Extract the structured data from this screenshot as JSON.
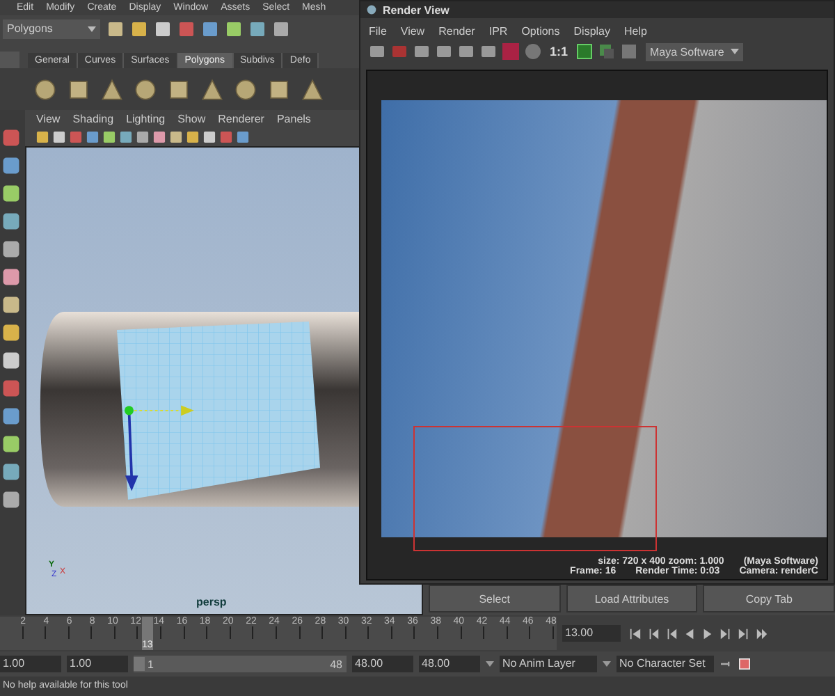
{
  "menu_bar": [
    "Edit",
    "Modify",
    "Create",
    "Display",
    "Window",
    "Assets",
    "Select",
    "Mesh"
  ],
  "menu_set": {
    "value": "Polygons"
  },
  "shelf_tabs": [
    {
      "label": "General",
      "selected": false
    },
    {
      "label": "Curves",
      "selected": false
    },
    {
      "label": "Surfaces",
      "selected": false
    },
    {
      "label": "Polygons",
      "selected": true
    },
    {
      "label": "Subdivs",
      "selected": false
    },
    {
      "label": "Defo",
      "selected": false
    }
  ],
  "panel_menu": [
    "View",
    "Shading",
    "Lighting",
    "Show",
    "Renderer",
    "Panels"
  ],
  "viewport": {
    "camera": "persp",
    "axis_labels": [
      "Y",
      "Z",
      "X"
    ]
  },
  "render_view": {
    "title": "Render View",
    "menu": [
      "File",
      "View",
      "Render",
      "IPR",
      "Options",
      "Display",
      "Help"
    ],
    "zoom_label": "1:1",
    "renderer": "Maya Software",
    "info_lines": [
      [
        "size: 720 x 400 zoom: 1.000",
        "(Maya Software)"
      ],
      [
        "Frame: 16",
        "Render Time: 0:03",
        "Camera: renderC"
      ]
    ]
  },
  "attribute_buttons": [
    "Select",
    "Load Attributes",
    "Copy Tab"
  ],
  "time_slider": {
    "ticks": [
      "2",
      "4",
      "6",
      "8",
      "10",
      "12",
      "14",
      "16",
      "18",
      "20",
      "22",
      "24",
      "26",
      "28",
      "30",
      "32",
      "34",
      "36",
      "38",
      "40",
      "42",
      "44",
      "46",
      "48"
    ],
    "current_frame": "13",
    "level": 0.255,
    "current_time": "13.00"
  },
  "range": {
    "start": "1.00",
    "playback_start": "1.00",
    "slider_start": "1",
    "slider_end": "48",
    "playback_end": "48.00",
    "end": "48.00",
    "level": 1,
    "anim_layer": "No Anim Layer",
    "character_set": "No Character Set"
  },
  "help_line": "No help available for this tool"
}
